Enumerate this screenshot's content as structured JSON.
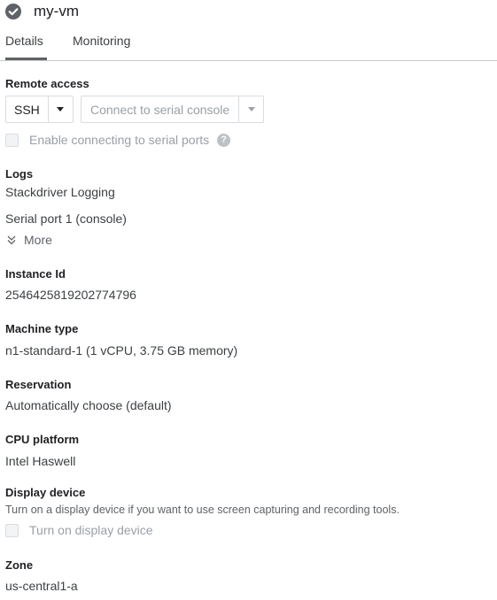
{
  "header": {
    "status_icon": "check-circle-icon",
    "title": "my-vm"
  },
  "tabs": [
    {
      "label": "Details",
      "active": true
    },
    {
      "label": "Monitoring",
      "active": false
    }
  ],
  "remote_access": {
    "label": "Remote access",
    "ssh_button": "SSH",
    "serial_button": "Connect to serial console",
    "serial_checkbox_label": "Enable connecting to serial ports",
    "serial_checkbox_checked": false
  },
  "logs": {
    "label": "Logs",
    "stackdriver": "Stackdriver Logging",
    "serial_port": "Serial port 1 (console)",
    "more": "More"
  },
  "instance_id": {
    "label": "Instance Id",
    "value": "2546425819202774796"
  },
  "machine_type": {
    "label": "Machine type",
    "value": "n1-standard-1 (1 vCPU, 3.75 GB memory)"
  },
  "reservation": {
    "label": "Reservation",
    "value": "Automatically choose (default)"
  },
  "cpu_platform": {
    "label": "CPU platform",
    "value": "Intel Haswell"
  },
  "display_device": {
    "label": "Display device",
    "help": "Turn on a display device if you want to use screen capturing and recording tools.",
    "checkbox_label": "Turn on display device",
    "checkbox_checked": false
  },
  "zone": {
    "label": "Zone",
    "value": "us-central1-a"
  },
  "colors": {
    "status_icon": "#5f6368",
    "disabled_text": "#9aa0a6",
    "label_text": "#202124"
  }
}
